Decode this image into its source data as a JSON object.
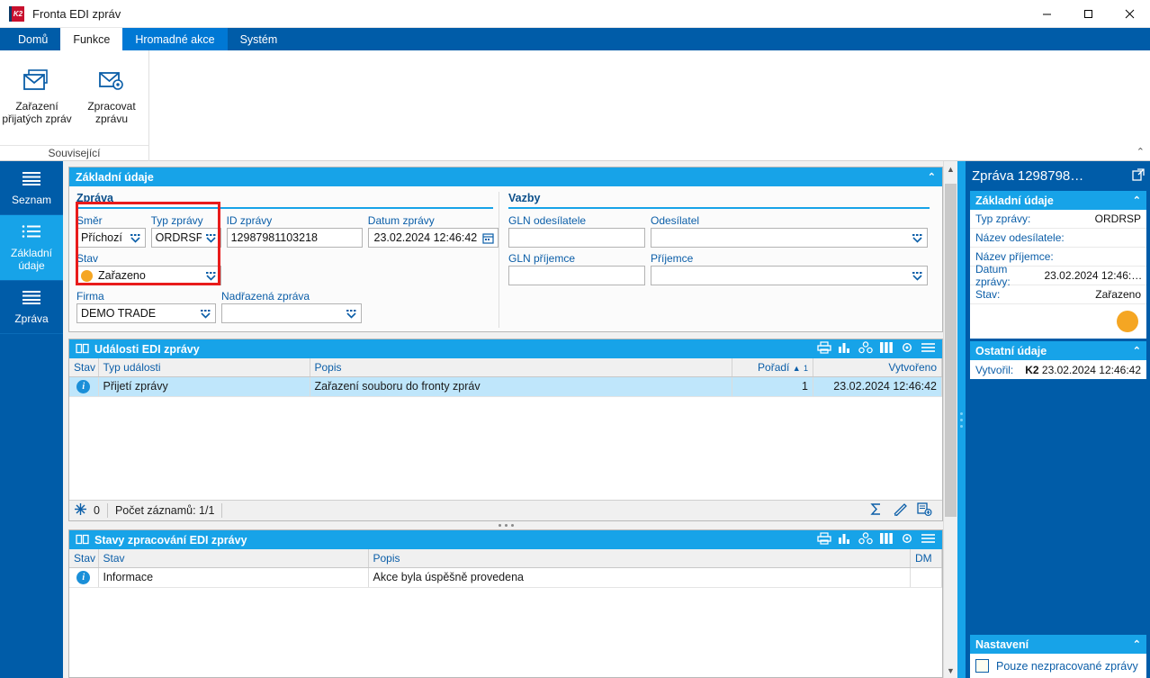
{
  "window": {
    "title": "Fronta EDI zpráv",
    "logo_text": "K2",
    "minimize": "—",
    "maximize": "☐",
    "close": "✕"
  },
  "ribbon": {
    "tabs": [
      {
        "label": "Domů",
        "state": "normal"
      },
      {
        "label": "Funkce",
        "state": "active"
      },
      {
        "label": "Hromadné akce",
        "state": "hover"
      },
      {
        "label": "Systém",
        "state": "normal"
      }
    ],
    "group": {
      "title": "Související",
      "buttons": [
        {
          "label": "Zařazení\npřijatých zpráv",
          "line1": "Zařazení",
          "line2": "přijatých zpráv",
          "icon": "envelope-icon"
        },
        {
          "label": "Zpracovat\nzprávu",
          "line1": "Zpracovat",
          "line2": "zprávu",
          "icon": "envelope-gear-icon"
        }
      ]
    },
    "collapse": "⌃"
  },
  "sidebar": {
    "items": [
      {
        "label": "Seznam",
        "icon": "list-lines-icon",
        "active": false
      },
      {
        "label_line1": "Základní",
        "label_line2": "údaje",
        "label": "Základní údaje",
        "icon": "list-bullets-icon",
        "active": true
      },
      {
        "label": "Zpráva",
        "icon": "list-lines-icon",
        "active": false
      }
    ]
  },
  "basic_panel": {
    "title": "Základní údaje",
    "collapse_chevron": "⌃",
    "message_group": {
      "title": "Zpráva",
      "fields": {
        "smer": {
          "label": "Směr",
          "value": "Příchozí"
        },
        "typ_zpravy": {
          "label": "Typ zprávy",
          "value": "ORDRSP"
        },
        "id_zpravy": {
          "label": "ID zprávy",
          "value": "12987981103218"
        },
        "datum_zpravy": {
          "label": "Datum zprávy",
          "value": "23.02.2024 12:46:42"
        },
        "stav": {
          "label": "Stav",
          "value": "Zařazeno",
          "dot_color": "#f5a623"
        },
        "firma": {
          "label": "Firma",
          "value": "DEMO TRADE"
        },
        "nadrazena": {
          "label": "Nadřazená zpráva",
          "value": ""
        }
      }
    },
    "links_group": {
      "title": "Vazby",
      "fields": {
        "gln_odesilatele": {
          "label": "GLN odesílatele",
          "value": ""
        },
        "odesilatel": {
          "label": "Odesílatel",
          "value": ""
        },
        "gln_prijemce": {
          "label": "GLN příjemce",
          "value": ""
        },
        "prijemce": {
          "label": "Příjemce",
          "value": ""
        }
      }
    }
  },
  "events_table": {
    "title": "Události EDI zprávy",
    "columns": [
      "Stav",
      "Typ události",
      "Popis",
      "Pořadí",
      "Vytvořeno"
    ],
    "sort_column": "Pořadí",
    "sort_direction": "▲",
    "sort_order": "1",
    "rows": [
      {
        "stav_icon": "info-icon",
        "typ_udalosti": "Přijetí zprávy",
        "popis": "Zařazení souboru do fronty zpráv",
        "poradi": "1",
        "vytvoreno": "23.02.2024 12:46:42"
      }
    ],
    "status": {
      "filter_icon": "snowflake-icon",
      "filter_count": "0",
      "record_count": "Počet záznamů: 1/1"
    },
    "tools": [
      "print-icon",
      "chart-icon",
      "group-icon",
      "columns-icon",
      "gear-icon",
      "menu-icon"
    ],
    "status_tools": [
      "sum-icon",
      "edit-icon",
      "new-document-icon"
    ]
  },
  "states_table": {
    "title": "Stavy zpracování EDI zprávy",
    "columns": [
      "Stav",
      "Stav",
      "Popis",
      "DM"
    ],
    "rows": [
      {
        "stav_icon": "info-icon",
        "stav": "Informace",
        "popis": "Akce byla úspěšně provedena",
        "dm": ""
      }
    ],
    "tools": [
      "print-icon",
      "chart-icon",
      "group-icon",
      "columns-icon",
      "gear-icon",
      "menu-icon"
    ]
  },
  "right_panel": {
    "title": "Zpráva 1298798…",
    "open_icon": "external-link-icon",
    "sections": [
      {
        "title": "Základní údaje",
        "chevron": "⌃",
        "rows": [
          {
            "key": "Typ zprávy:",
            "value": "ORDRSP"
          },
          {
            "key": "Název odesílatele:",
            "value": ""
          },
          {
            "key": "Název příjemce:",
            "value": ""
          },
          {
            "key": "Datum zprávy:",
            "value": "23.02.2024 12:46:…"
          },
          {
            "key": "Stav:",
            "value": "Zařazeno"
          }
        ],
        "status_dot_color": "#f5a623"
      },
      {
        "title": "Ostatní údaje",
        "chevron": "⌃",
        "rows": [
          {
            "key": "Vytvořil:",
            "value_bold": "K2",
            "value": "23.02.2024 12:46:42"
          }
        ]
      }
    ],
    "settings": {
      "title": "Nastavení",
      "chevron": "⌃",
      "checkbox_label": "Pouze nezpracované zprávy",
      "checked": false
    }
  },
  "colors": {
    "ribbon_blue": "#005ca8",
    "accent_cyan": "#17a3e8",
    "status_orange": "#f5a623",
    "highlight_red": "#e81b1b",
    "selection_blue": "#bfe6fb"
  }
}
